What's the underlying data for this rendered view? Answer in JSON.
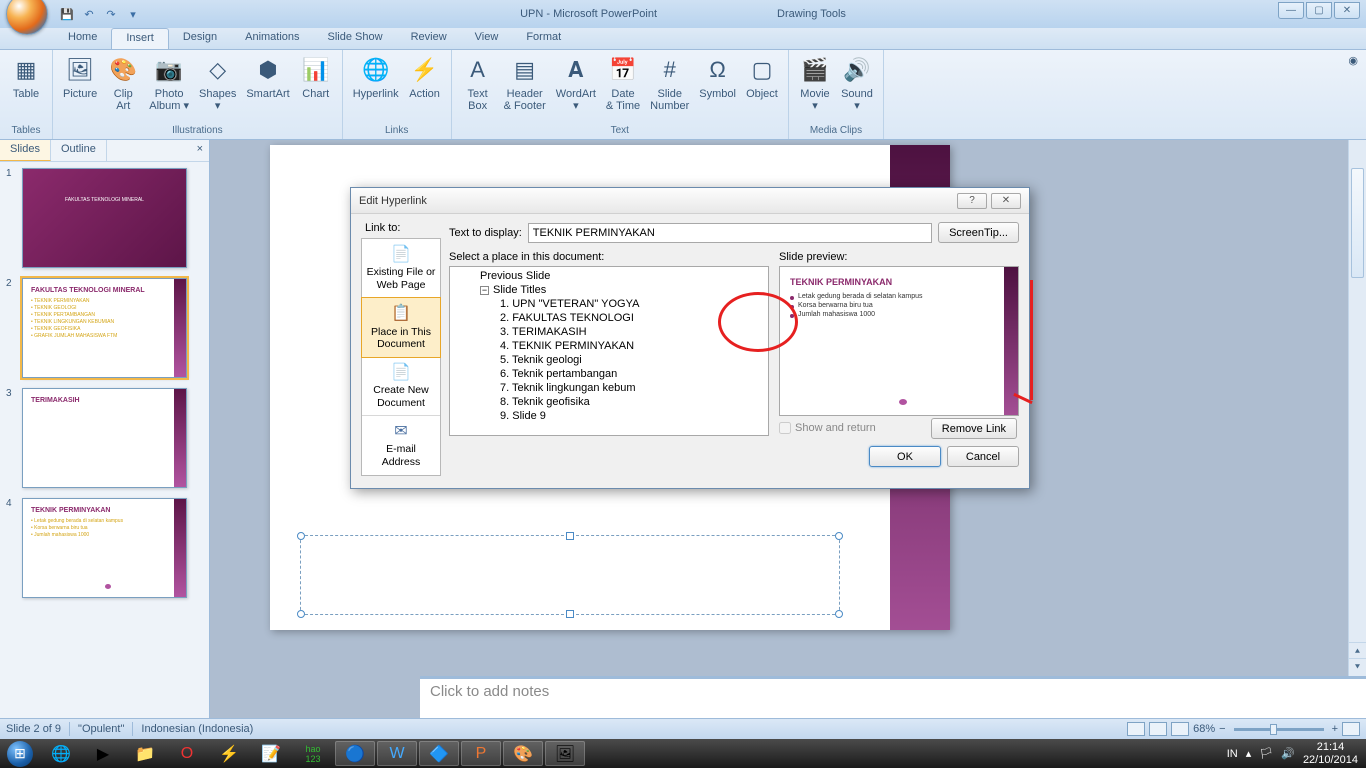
{
  "app": {
    "title": "UPN - Microsoft PowerPoint",
    "context_title": "Drawing Tools"
  },
  "tabs": [
    "Home",
    "Insert",
    "Design",
    "Animations",
    "Slide Show",
    "Review",
    "View",
    "Format"
  ],
  "active_tab": "Insert",
  "ribbon": {
    "tables": {
      "label": "Tables",
      "items": [
        {
          "label": "Table",
          "icon": "▦"
        }
      ]
    },
    "illustrations": {
      "label": "Illustrations",
      "items": [
        {
          "label": "Picture",
          "icon": "🖼"
        },
        {
          "label": "Clip\nArt",
          "icon": "🎨"
        },
        {
          "label": "Photo\nAlbum ▾",
          "icon": "📷"
        },
        {
          "label": "Shapes\n▾",
          "icon": "◇"
        },
        {
          "label": "SmartArt",
          "icon": "⬢"
        },
        {
          "label": "Chart",
          "icon": "📊"
        }
      ]
    },
    "links": {
      "label": "Links",
      "items": [
        {
          "label": "Hyperlink",
          "icon": "🌐"
        },
        {
          "label": "Action",
          "icon": "⚡"
        }
      ]
    },
    "text": {
      "label": "Text",
      "items": [
        {
          "label": "Text\nBox",
          "icon": "A"
        },
        {
          "label": "Header\n& Footer",
          "icon": "▤"
        },
        {
          "label": "WordArt\n▾",
          "icon": "𝐀"
        },
        {
          "label": "Date\n& Time",
          "icon": "📅"
        },
        {
          "label": "Slide\nNumber",
          "icon": "#"
        },
        {
          "label": "Symbol",
          "icon": "Ω"
        },
        {
          "label": "Object",
          "icon": "▢"
        }
      ]
    },
    "media": {
      "label": "Media Clips",
      "items": [
        {
          "label": "Movie\n▾",
          "icon": "🎬"
        },
        {
          "label": "Sound\n▾",
          "icon": "🔊"
        }
      ]
    }
  },
  "slide_panel": {
    "tabs": [
      "Slides",
      "Outline"
    ]
  },
  "thumbnails": [
    {
      "num": "1",
      "style": "purple",
      "title": "",
      "subtitle": "FAKULTAS TEKNOLOGI MINERAL"
    },
    {
      "num": "2",
      "style": "links",
      "title": "FAKULTAS TEKNOLOGI MINERAL",
      "lines": [
        "TEKNIK PERMINYAKAN",
        "TEKNIK GEOLOGI",
        "TEKNIK PERTAMBANGAN",
        "TEKNIK LINGKUNGAN KEBUMIAN",
        "TEKNIK GEOFISIKA",
        "GRAFIK JUMLAH MAHASISWA FTM"
      ]
    },
    {
      "num": "3",
      "style": "simple",
      "title": "TERIMAKASIH"
    },
    {
      "num": "4",
      "style": "content",
      "title": "TEKNIK PERMINYAKAN",
      "lines": [
        "Letak gedung berada di selatan kampus",
        "Korsa berwarna biru tua",
        "Jumlah mahasiswa 1000"
      ]
    }
  ],
  "notes_placeholder": "Click to add notes",
  "status": {
    "slide": "Slide 2 of 9",
    "theme": "\"Opulent\"",
    "lang": "Indonesian (Indonesia)",
    "zoom": "68%"
  },
  "dialog": {
    "title": "Edit Hyperlink",
    "link_to_label": "Link to:",
    "text_display_label": "Text to display:",
    "text_display_value": "TEKNIK PERMINYAKAN",
    "screentip": "ScreenTip...",
    "linkto": [
      {
        "label": "Existing File or\nWeb Page",
        "icon": "📄"
      },
      {
        "label": "Place in This\nDocument",
        "icon": "📋",
        "selected": true
      },
      {
        "label": "Create New\nDocument",
        "icon": "📄"
      },
      {
        "label": "E-mail Address",
        "icon": "✉"
      }
    ],
    "tree_label": "Select a place in this document:",
    "tree": [
      {
        "t": "Previous Slide",
        "lvl": 2
      },
      {
        "t": "Slide Titles",
        "lvl": 2,
        "exp": "−"
      },
      {
        "t": "1. UPN \"VETERAN\" YOGYA",
        "lvl": 3
      },
      {
        "t": "2. FAKULTAS TEKNOLOGI",
        "lvl": 3
      },
      {
        "t": "3. TERIMAKASIH",
        "lvl": 3
      },
      {
        "t": "4. TEKNIK PERMINYAKAN",
        "lvl": 3
      },
      {
        "t": "5. Teknik geologi",
        "lvl": 3
      },
      {
        "t": "6. Teknik pertambangan",
        "lvl": 3
      },
      {
        "t": "7. Teknik lingkungan kebum",
        "lvl": 3
      },
      {
        "t": "8. Teknik geofisika",
        "lvl": 3
      },
      {
        "t": "9. Slide 9",
        "lvl": 3
      }
    ],
    "preview_label": "Slide preview:",
    "preview": {
      "title": "TEKNIK PERMINYAKAN",
      "bullets": [
        "Letak gedung berada di selatan kampus",
        "Korsa berwarna biru tua",
        "Jumlah mahasiswa 1000"
      ]
    },
    "show_return": "Show and return",
    "remove": "Remove Link",
    "ok": "OK",
    "cancel": "Cancel"
  },
  "tray": {
    "lang": "IN",
    "time": "21:14",
    "date": "22/10/2014"
  }
}
